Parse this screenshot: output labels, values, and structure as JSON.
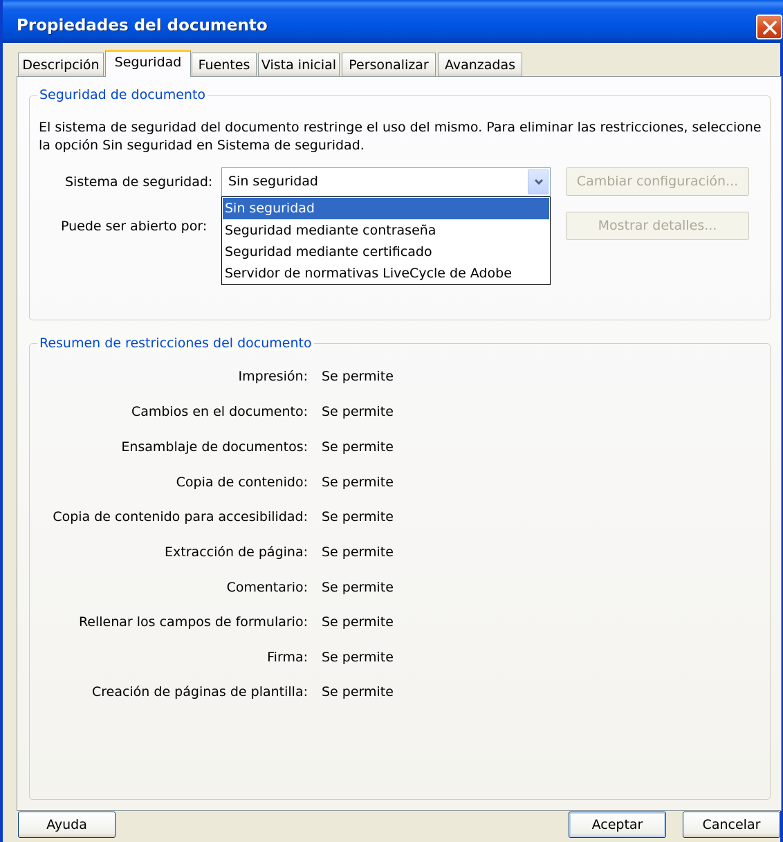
{
  "window": {
    "title": "Propiedades del documento"
  },
  "tabs": [
    {
      "label": "Descripción"
    },
    {
      "label": "Seguridad"
    },
    {
      "label": "Fuentes"
    },
    {
      "label": "Vista inicial"
    },
    {
      "label": "Personalizar"
    },
    {
      "label": "Avanzadas"
    }
  ],
  "security_group": {
    "legend": "Seguridad de documento",
    "description": "El sistema de seguridad del documento restringe el uso del mismo. Para eliminar las restricciones, seleccione la opción Sin seguridad en Sistema de seguridad.",
    "system_label": "Sistema de seguridad:",
    "system_value": "Sin seguridad",
    "options": [
      "Sin seguridad",
      "Seguridad mediante contraseña",
      "Seguridad mediante certificado",
      "Servidor de normativas LiveCycle de Adobe"
    ],
    "change_button": "Cambiar configuración...",
    "open_label": "Puede ser abierto por:",
    "details_button": "Mostrar detalles..."
  },
  "restrictions_group": {
    "legend": "Resumen de restricciones del documento",
    "rows": [
      {
        "label": "Impresión:",
        "value": "Se permite"
      },
      {
        "label": "Cambios en el documento:",
        "value": "Se permite"
      },
      {
        "label": "Ensamblaje de documentos:",
        "value": "Se permite"
      },
      {
        "label": "Copia de contenido:",
        "value": "Se permite"
      },
      {
        "label": "Copia de contenido para accesibilidad:",
        "value": "Se permite"
      },
      {
        "label": "Extracción de página:",
        "value": "Se permite"
      },
      {
        "label": "Comentario:",
        "value": "Se permite"
      },
      {
        "label": "Rellenar los campos de formulario:",
        "value": "Se permite"
      },
      {
        "label": "Firma:",
        "value": "Se permite"
      },
      {
        "label": "Creación de páginas de plantilla:",
        "value": "Se permite"
      }
    ]
  },
  "footer": {
    "help_button": "Ayuda",
    "ok_button": "Aceptar",
    "cancel_button": "Cancelar"
  }
}
